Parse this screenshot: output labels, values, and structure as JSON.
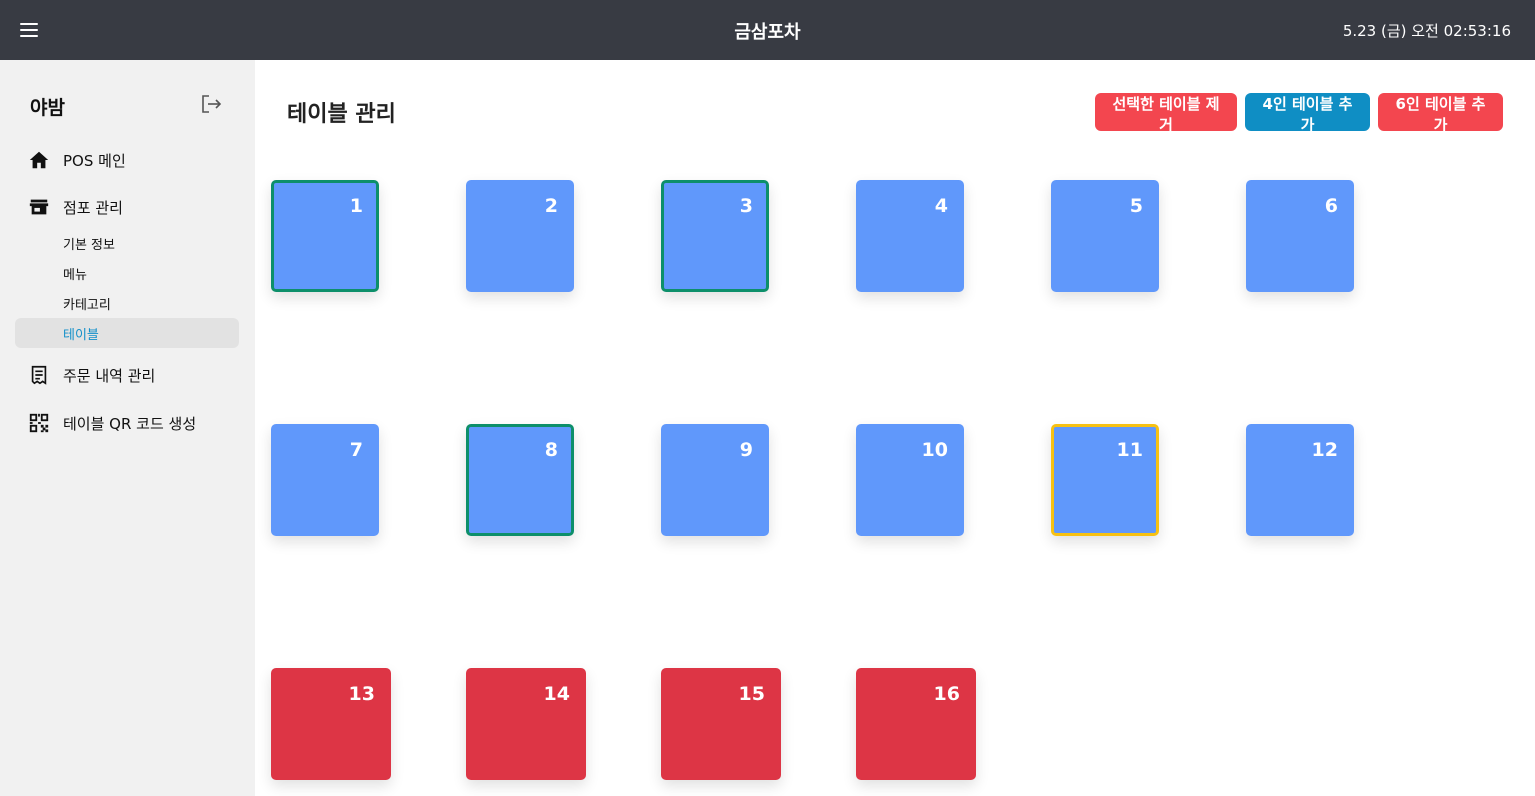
{
  "header": {
    "app_title": "금삼포차",
    "datetime": "5.23 (금) 오전 02:53:16",
    "menu_icon": "hamburger-menu-icon"
  },
  "sidebar": {
    "store_name": "야밤",
    "logout_icon": "logout-icon",
    "nav": {
      "pos_main": {
        "label": "POS 메인",
        "icon": "home-icon"
      },
      "store_manage": {
        "label": "점포 관리",
        "icon": "store-icon"
      },
      "sub_items": [
        {
          "label": "기본 정보",
          "active": false
        },
        {
          "label": "메뉴",
          "active": false
        },
        {
          "label": "카테고리",
          "active": false
        },
        {
          "label": "테이블",
          "active": true
        }
      ],
      "orders": {
        "label": "주문 내역 관리",
        "icon": "receipt-icon"
      },
      "qr": {
        "label": "테이블 QR 코드 생성",
        "icon": "qr-code-icon"
      }
    },
    "active_color": "#1490c9"
  },
  "main": {
    "title": "테이블 관리",
    "buttons": {
      "remove_selected": "선택한 테이블 제거",
      "add_4_person": "4인 테이블 추가",
      "add_6_person": "6인 테이블 추가"
    },
    "tables": [
      {
        "number": "1",
        "size": 4,
        "state": "selected"
      },
      {
        "number": "2",
        "size": 4,
        "state": "normal"
      },
      {
        "number": "3",
        "size": 4,
        "state": "selected"
      },
      {
        "number": "4",
        "size": 4,
        "state": "normal"
      },
      {
        "number": "5",
        "size": 4,
        "state": "normal"
      },
      {
        "number": "6",
        "size": 4,
        "state": "normal"
      },
      {
        "number": "7",
        "size": 4,
        "state": "normal"
      },
      {
        "number": "8",
        "size": 4,
        "state": "selected"
      },
      {
        "number": "9",
        "size": 4,
        "state": "normal"
      },
      {
        "number": "10",
        "size": 4,
        "state": "normal"
      },
      {
        "number": "11",
        "size": 4,
        "state": "highlighted"
      },
      {
        "number": "12",
        "size": 4,
        "state": "normal"
      },
      {
        "number": "13",
        "size": 6,
        "state": "normal"
      },
      {
        "number": "14",
        "size": 6,
        "state": "normal"
      },
      {
        "number": "15",
        "size": 6,
        "state": "normal"
      },
      {
        "number": "16",
        "size": 6,
        "state": "normal"
      }
    ]
  },
  "colors": {
    "topbar": "#383b43",
    "table_4": "#6098fb",
    "table_6": "#dd3545",
    "selected_border": "#0d8f6a",
    "highlight_border": "#f7c112",
    "danger_button": "#f3464f",
    "primary_button": "#0f8ec4"
  }
}
